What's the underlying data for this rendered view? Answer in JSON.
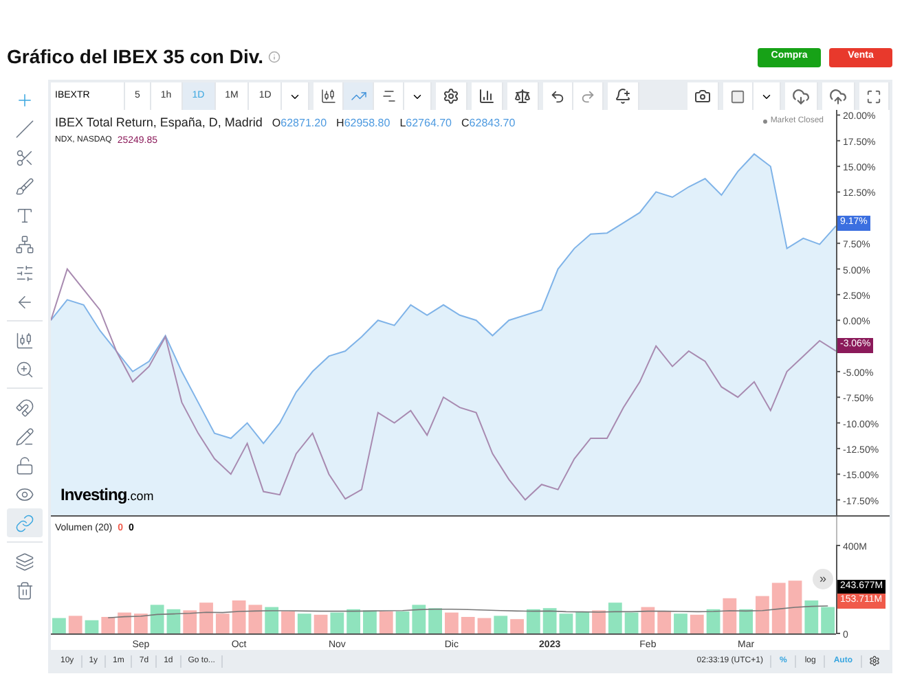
{
  "header": {
    "title": "Gráfico del IBEX 35 con Div.",
    "buttons": [
      {
        "label": "Compra",
        "kind": "buy"
      },
      {
        "label": "Venta",
        "kind": "sell"
      }
    ]
  },
  "left_tools": [
    {
      "selected": true
    },
    {
      "selected": false
    },
    {
      "selected": false
    },
    {
      "selected": false
    },
    {
      "selected": false
    },
    {
      "selected": false
    },
    {
      "selected": false
    },
    {
      "selected": false
    },
    {
      "selected": false
    },
    {
      "selected": false
    },
    {
      "selected": false
    },
    {
      "selected": false
    },
    {
      "selected": false
    },
    {
      "selected": false
    },
    {
      "selected": true
    },
    {
      "selected": false
    },
    {
      "selected": false
    }
  ],
  "toolbar": {
    "symbol": "IBEXTR",
    "intervals": [
      {
        "label": "5",
        "selected": false
      },
      {
        "label": "1h",
        "selected": false
      },
      {
        "label": "1D",
        "selected": true
      },
      {
        "label": "1M",
        "selected": false
      },
      {
        "label": "1D",
        "selected": false
      }
    ],
    "chart_types": [
      {
        "selected": false
      },
      {
        "selected": true
      },
      {
        "selected": false
      }
    ]
  },
  "legend": {
    "main": {
      "ohlc": [
        {
          "label": "O",
          "value": "62871.20"
        },
        {
          "label": "H",
          "value": "62958.80"
        },
        {
          "label": "L",
          "value": "62764.70"
        },
        {
          "label": "C",
          "value": "62843.70"
        }
      ]
    },
    "compare": {
      "value": "25249.85"
    },
    "status": "Market Closed"
  },
  "price_labels": [
    {
      "text": "9.17%",
      "color": "#3b6fe0"
    },
    {
      "text": "-3.06%",
      "color": "#8b1a5a"
    }
  ],
  "logo": {
    "name": "Investing",
    "suffix": ".com"
  },
  "chart_data": {
    "type": "area",
    "series": [
      {
        "name": "IBEX Total Return, España, D, Madrid",
        "color": "#7fb3e8",
        "values": [
          0,
          2,
          1.5,
          -1,
          -3,
          -5,
          -4,
          -1.5,
          -5,
          -8,
          -11,
          -11.5,
          -10,
          -12,
          -10,
          -7,
          -5,
          -3.5,
          -3,
          -1.6,
          0,
          -0.5,
          1.5,
          0.5,
          1.5,
          0.5,
          0,
          -1.5,
          0,
          0.5,
          1,
          5,
          7,
          8.4,
          8.5,
          9.5,
          10.5,
          12.5,
          12,
          13,
          13.8,
          12.2,
          14.5,
          16.2,
          15,
          7,
          8,
          7.4,
          9.2
        ]
      },
      {
        "name": "NDX, NASDAQ",
        "type": "line",
        "color": "#a88ab0",
        "values": [
          0,
          5,
          3,
          1,
          -3,
          -6,
          -4.5,
          -1.6,
          -8,
          -11,
          -13.5,
          -15,
          -12,
          -16.7,
          -17,
          -13,
          -11,
          -15,
          -17.4,
          -16.5,
          -9,
          -10,
          -8.8,
          -11.2,
          -7.5,
          -8.5,
          -9,
          -13,
          -15.5,
          -17.5,
          -16,
          -16.5,
          -13.5,
          -11.5,
          -11.5,
          -8.5,
          -6,
          -2.5,
          -4.5,
          -3,
          -4,
          -6.5,
          -7.5,
          -6,
          -8.8,
          -5,
          -3.5,
          -2,
          -3
        ]
      }
    ],
    "ylim": [
      -19,
      20.5
    ],
    "yticks": [
      {
        "value": 20,
        "label": "20.00%"
      },
      {
        "value": 17.5,
        "label": "17.50%"
      },
      {
        "value": 15,
        "label": "15.00%"
      },
      {
        "value": 12.5,
        "label": "12.50%"
      },
      {
        "value": 7.5,
        "label": "7.50%"
      },
      {
        "value": 5,
        "label": "5.00%"
      },
      {
        "value": 2.5,
        "label": "2.50%"
      },
      {
        "value": 0,
        "label": "0.00%"
      },
      {
        "value": -5,
        "label": "-5.00%"
      },
      {
        "value": -7.5,
        "label": "-7.50%"
      },
      {
        "value": -10,
        "label": "-10.00%"
      },
      {
        "value": -12.5,
        "label": "-12.50%"
      },
      {
        "value": -15,
        "label": "-15.00%"
      },
      {
        "value": -17.5,
        "label": "-17.50%"
      }
    ]
  },
  "volume": {
    "values": [
      {
        "text": "0",
        "color": "#f05a4a"
      },
      {
        "text": "0",
        "color": "#000000"
      }
    ],
    "labels": [
      {
        "text": "243.677M",
        "color": "#000000"
      },
      {
        "text": "153.711M",
        "color": "#f05a4a"
      }
    ],
    "scroll_button": "»",
    "chart_data": {
      "type": "bar",
      "categories": [
        null,
        null,
        null,
        null,
        null,
        "Sep",
        null,
        null,
        null,
        null,
        null,
        "Oct",
        null,
        null,
        null,
        null,
        null,
        "Nov",
        null,
        null,
        null,
        null,
        null,
        null,
        "Dic",
        null,
        null,
        null,
        null,
        null,
        "2023",
        null,
        null,
        null,
        null,
        null,
        "Feb",
        null,
        null,
        null,
        null,
        null,
        "Mar",
        null,
        null,
        null,
        null,
        null
      ],
      "series": [
        {
          "color": "#8fe3bd",
          "values": [
            70,
            null,
            60,
            null,
            null,
            null,
            130,
            110,
            null,
            null,
            null,
            null,
            null,
            120,
            null,
            90,
            null,
            95,
            110,
            105,
            null,
            100,
            130,
            115,
            null,
            null,
            null,
            80,
            null,
            110,
            115,
            90,
            100,
            null,
            140,
            95,
            null,
            null,
            90,
            null,
            110,
            null,
            110,
            null,
            null,
            null,
            150,
            120
          ]
        },
        {
          "color": "#f8b3b0",
          "values": [
            null,
            80,
            null,
            75,
            95,
            90,
            null,
            null,
            105,
            140,
            90,
            150,
            130,
            null,
            100,
            null,
            85,
            null,
            null,
            null,
            100,
            null,
            null,
            null,
            95,
            75,
            70,
            null,
            65,
            null,
            null,
            null,
            null,
            105,
            null,
            null,
            120,
            100,
            null,
            85,
            null,
            160,
            null,
            170,
            230,
            240,
            null,
            null
          ]
        },
        {
          "name": "Volumen (20)",
          "type": "line",
          "color": "#777777",
          "values": [
            null,
            null,
            null,
            71,
            76,
            78,
            86,
            89,
            91,
            96,
            95,
            100,
            102,
            103,
            103,
            102,
            101,
            101,
            101,
            102,
            103,
            104,
            108,
            110,
            110,
            109,
            106,
            104,
            102,
            101,
            102,
            99,
            98,
            97,
            99,
            99,
            101,
            101,
            100,
            99,
            100,
            103,
            102,
            104,
            111,
            119,
            123,
            125
          ]
        }
      ],
      "ylim": [
        0,
        400
      ],
      "yticks": [
        {
          "value": 0,
          "label": "0"
        },
        {
          "value": 400,
          "label": "400M"
        }
      ]
    }
  },
  "bottom_bar": {
    "ranges": [
      "10y",
      "1y",
      "1m",
      "7d",
      "1d",
      "Go to..."
    ],
    "time": "02:33:19 (UTC+1)",
    "scales": [
      {
        "label": "%",
        "selected": true
      },
      {
        "label": "log",
        "selected": false
      },
      {
        "label": "Auto",
        "selected": true
      }
    ]
  }
}
